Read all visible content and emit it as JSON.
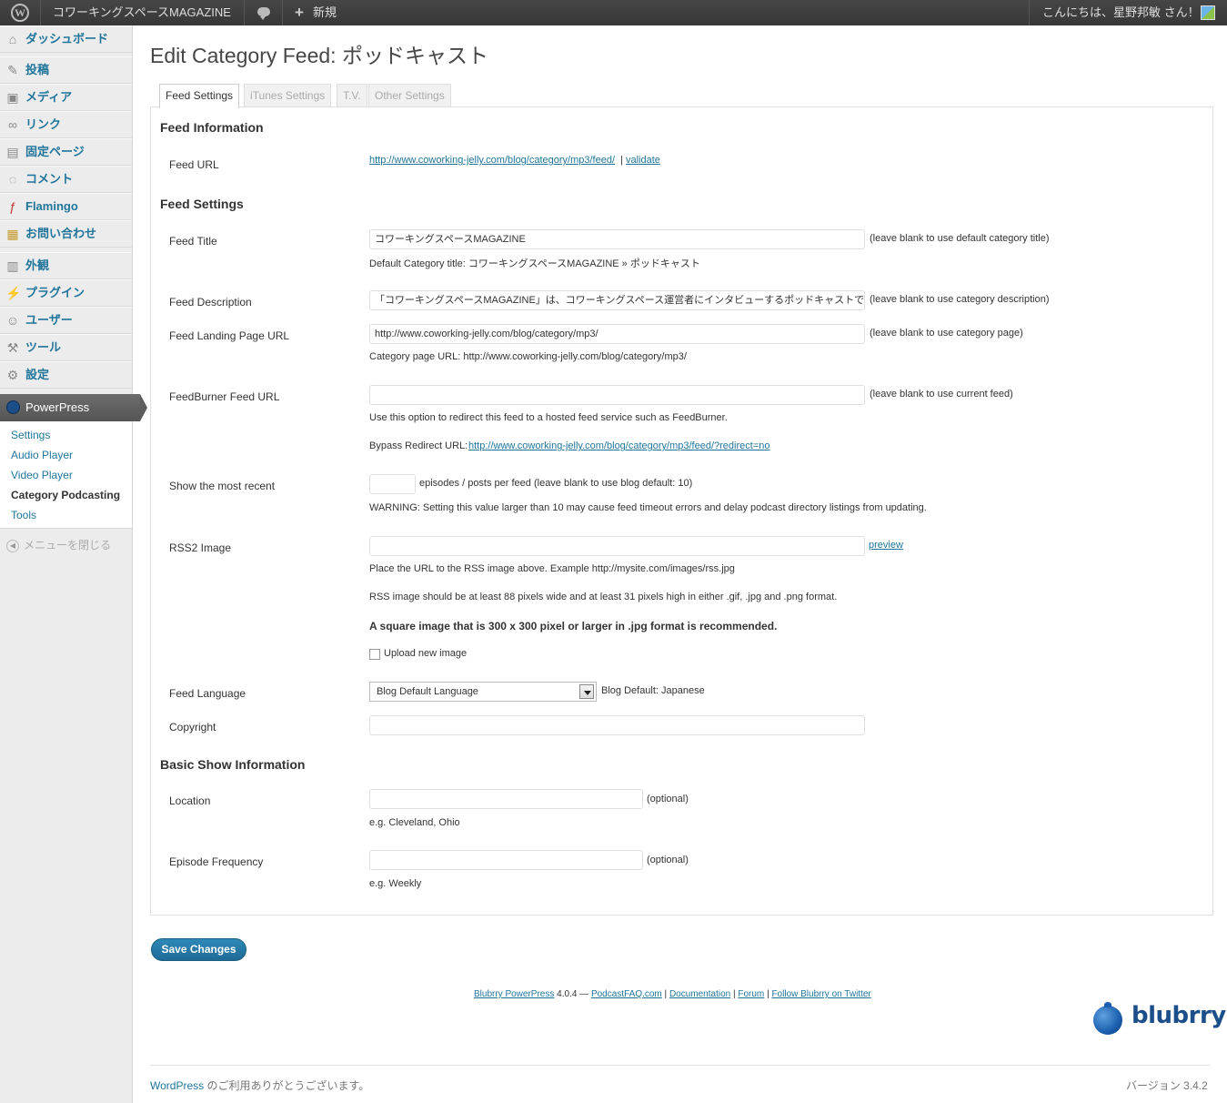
{
  "adminbar": {
    "site_name": "コワーキングスペースMAGAZINE",
    "new_label": "新規",
    "greeting": "こんにちは、星野邦敏 さん！"
  },
  "sidebar": {
    "items": [
      {
        "label": "ダッシュボード",
        "icon": "dashboard-icon"
      },
      {
        "label": "投稿",
        "icon": "pin-icon"
      },
      {
        "label": "メディア",
        "icon": "media-icon"
      },
      {
        "label": "リンク",
        "icon": "link-icon"
      },
      {
        "label": "固定ページ",
        "icon": "page-icon"
      },
      {
        "label": "コメント",
        "icon": "comment-icon"
      },
      {
        "label": "Flamingo",
        "icon": "flamingo-icon"
      },
      {
        "label": "お問い合わせ",
        "icon": "contact-icon"
      },
      {
        "label": "外観",
        "icon": "appearance-icon"
      },
      {
        "label": "プラグイン",
        "icon": "plugin-icon"
      },
      {
        "label": "ユーザー",
        "icon": "users-icon"
      },
      {
        "label": "ツール",
        "icon": "tools-icon"
      },
      {
        "label": "設定",
        "icon": "settings-icon"
      }
    ],
    "powerpress": "PowerPress",
    "submenu": [
      "Settings",
      "Audio Player",
      "Video Player",
      "Category Podcasting",
      "Tools"
    ],
    "collapse": "メニューを閉じる"
  },
  "page": {
    "title": "Edit Category Feed: ポッドキャスト",
    "tabs": [
      "Feed Settings",
      "iTunes Settings",
      "T.V.",
      "Other Settings"
    ]
  },
  "sections": {
    "feed_information": "Feed Information",
    "feed_settings": "Feed Settings",
    "basic_show": "Basic Show Information"
  },
  "fields": {
    "feed_url": {
      "label": "Feed URL",
      "url": "http://www.coworking-jelly.com/blog/category/mp3/feed/",
      "separator": "|",
      "validate": "validate"
    },
    "feed_title": {
      "label": "Feed Title",
      "value": "コワーキングスペースMAGAZINE",
      "hint": "(leave blank to use default category title)",
      "note": "Default Category title: コワーキングスペースMAGAZINE » ポッドキャスト"
    },
    "feed_description": {
      "label": "Feed Description",
      "value": "「コワーキングスペースMAGAZINE」は、コワーキングスペース運営者にインタビューするポッドキャストで",
      "hint": "(leave blank to use category description)"
    },
    "landing_page": {
      "label": "Feed Landing Page URL",
      "value": "http://www.coworking-jelly.com/blog/category/mp3/",
      "hint": "(leave blank to use category page)",
      "note": "Category page URL: http://www.coworking-jelly.com/blog/category/mp3/"
    },
    "feedburner": {
      "label": "FeedBurner Feed URL",
      "value": "",
      "hint": "(leave blank to use current feed)",
      "note": "Use this option to redirect this feed to a hosted feed service such as FeedBurner.",
      "bypass_label": "Bypass Redirect URL:",
      "bypass_url": "http://www.coworking-jelly.com/blog/category/mp3/feed/?redirect=no"
    },
    "most_recent": {
      "label": "Show the most recent",
      "value": "",
      "hint": "episodes / posts per feed (leave blank to use blog default: 10)",
      "warning": "WARNING: Setting this value larger than 10 may cause feed timeout errors and delay podcast directory listings from updating."
    },
    "rss2_image": {
      "label": "RSS2 Image",
      "value": "",
      "preview": "preview",
      "note1": "Place the URL to the RSS image above. Example http://mysite.com/images/rss.jpg",
      "note2": "RSS image should be at least 88 pixels wide and at least 31 pixels high in either .gif, .jpg and .png format.",
      "note3": "A square image that is 300 x 300 pixel or larger in .jpg format is recommended.",
      "upload": "Upload new image"
    },
    "feed_language": {
      "label": "Feed Language",
      "selected": "Blog Default Language",
      "default_note": "Blog Default: Japanese"
    },
    "copyright": {
      "label": "Copyright",
      "value": ""
    },
    "location": {
      "label": "Location",
      "value": "",
      "hint": "(optional)",
      "example": "e.g. Cleveland, Ohio"
    },
    "episode_frequency": {
      "label": "Episode Frequency",
      "value": "",
      "hint": "(optional)",
      "example": "e.g. Weekly"
    }
  },
  "save_label": "Save Changes",
  "pp_footer": {
    "product": "Blubrry PowerPress",
    "version": "4.0.4 —",
    "links": [
      "PodcastFAQ.com",
      "Documentation",
      "Forum",
      "Follow Blubrry on Twitter"
    ],
    "sep": "|"
  },
  "blubrry_logo": "blubrry",
  "footer": {
    "wordpress": "WordPress",
    "thanks": "のご利用ありがとうございます。",
    "version": "バージョン 3.4.2"
  }
}
